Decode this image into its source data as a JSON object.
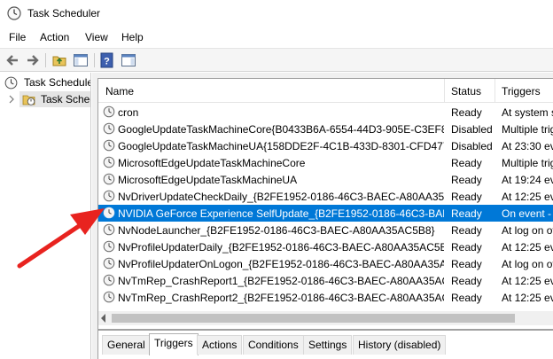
{
  "window": {
    "title": "Task Scheduler"
  },
  "menu": {
    "items": [
      "File",
      "Action",
      "View",
      "Help"
    ]
  },
  "tree": {
    "root": "Task Scheduler",
    "child": "Task Scheduler Library"
  },
  "columns": {
    "name": "Name",
    "status": "Status",
    "triggers": "Triggers"
  },
  "tasks": [
    {
      "name": "cron",
      "status": "Ready",
      "trigger": "At system st"
    },
    {
      "name": "GoogleUpdateTaskMachineCore{B0433B6A-6554-44D3-905E-C3EF8...",
      "status": "Disabled",
      "trigger": "Multiple trig"
    },
    {
      "name": "GoogleUpdateTaskMachineUA{158DDE2F-4C1B-433D-8301-CFD477...",
      "status": "Disabled",
      "trigger": "At 23:30 eve"
    },
    {
      "name": "MicrosoftEdgeUpdateTaskMachineCore",
      "status": "Ready",
      "trigger": "Multiple trig"
    },
    {
      "name": "MicrosoftEdgeUpdateTaskMachineUA",
      "status": "Ready",
      "trigger": "At 19:24 eve"
    },
    {
      "name": "NvDriverUpdateCheckDaily_{B2FE1952-0186-46C3-BAEC-A80AA35A...",
      "status": "Ready",
      "trigger": "At 12:25 eve"
    },
    {
      "name": "NVIDIA GeForce Experience SelfUpdate_{B2FE1952-0186-46C3-BAEC...",
      "status": "Ready",
      "trigger": "On event - L"
    },
    {
      "name": "NvNodeLauncher_{B2FE1952-0186-46C3-BAEC-A80AA35AC5B8}",
      "status": "Ready",
      "trigger": "At log on of"
    },
    {
      "name": "NvProfileUpdaterDaily_{B2FE1952-0186-46C3-BAEC-A80AA35AC5B8}",
      "status": "Ready",
      "trigger": "At 12:25 eve"
    },
    {
      "name": "NvProfileUpdaterOnLogon_{B2FE1952-0186-46C3-BAEC-A80AA35AC5...",
      "status": "Ready",
      "trigger": "At log on of"
    },
    {
      "name": "NvTmRep_CrashReport1_{B2FE1952-0186-46C3-BAEC-A80AA35AC5...",
      "status": "Ready",
      "trigger": "At 12:25 eve"
    },
    {
      "name": "NvTmRep_CrashReport2_{B2FE1952-0186-46C3-BAEC-A80AA35AC5...",
      "status": "Ready",
      "trigger": "At 12:25 eve"
    }
  ],
  "selected_row": 6,
  "tabs": [
    "General",
    "Triggers",
    "Actions",
    "Conditions",
    "Settings",
    "History (disabled)"
  ],
  "active_tab": "Triggers",
  "colors": {
    "selection": "#0078d7",
    "annotation_arrow": "#e8231f"
  }
}
